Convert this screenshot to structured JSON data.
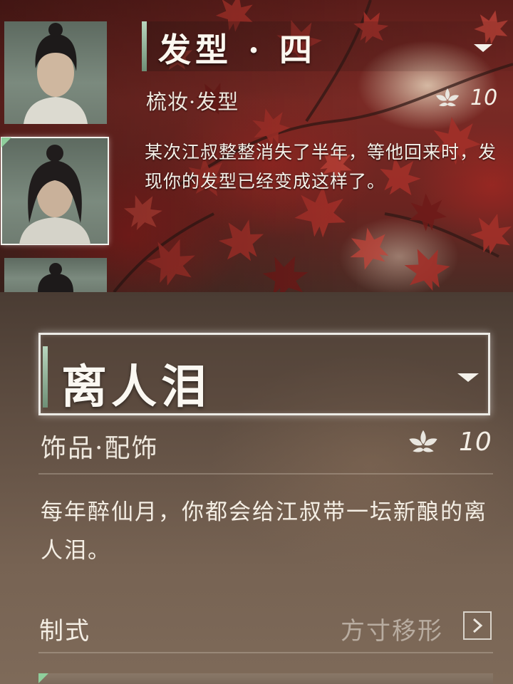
{
  "top_item": {
    "title": "发型 · 四",
    "category": "梳妆·发型",
    "cost": "10",
    "description": "某次江叔整整消失了半年，等他回来时，发现你的发型已经变成这样了。"
  },
  "main_item": {
    "title": "离人泪",
    "category": "饰品·配饰",
    "cost": "10",
    "description": "每年醉仙月，你都会给江叔带一坛新酿的离人泪。",
    "style_label": "制式",
    "style_value": "方寸移形"
  },
  "portraits": [
    {
      "name": "hairstyle-portrait-1",
      "selected": false
    },
    {
      "name": "hairstyle-portrait-2",
      "selected": true
    },
    {
      "name": "hairstyle-portrait-3",
      "selected": false
    }
  ],
  "icons": {
    "currency": "lotus-currency-icon",
    "dropdown": "triangle-down-icon",
    "navigate": "chevron-right-icon"
  },
  "colors": {
    "accent_green": "#8fcf9c",
    "selected_border": "#f3f3ee",
    "muted_text": "#b8aca0"
  }
}
